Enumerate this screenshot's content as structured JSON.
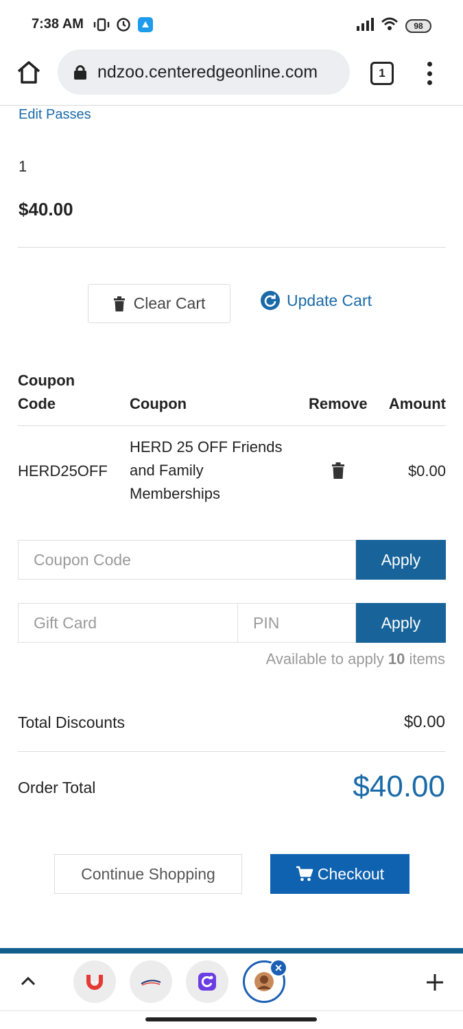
{
  "status_bar": {
    "time": "7:38 AM",
    "battery": "98"
  },
  "browser": {
    "url": "ndzoo.centeredgeonline.com",
    "tab_count": "1"
  },
  "cart_item": {
    "edit_link": "Edit Passes",
    "quantity": "1",
    "price": "$40.00"
  },
  "cart_actions": {
    "clear_label": "Clear Cart",
    "update_label": "Update Cart"
  },
  "coupon_table": {
    "headers": {
      "code_line1": "Coupon",
      "code_line2": "Code",
      "coupon": "Coupon",
      "remove": "Remove",
      "amount": "Amount"
    },
    "rows": [
      {
        "code": "HERD25OFF",
        "desc_line1": "HERD 25 OFF Friends",
        "desc_line2": "and Family",
        "desc_line3": "Memberships",
        "amount": "$0.00"
      }
    ]
  },
  "coupon_form": {
    "placeholder": "Coupon Code",
    "apply_label": "Apply"
  },
  "gift_card_form": {
    "card_placeholder": "Gift Card",
    "pin_placeholder": "PIN",
    "apply_label": "Apply"
  },
  "availability": {
    "prefix": "Available to apply",
    "count": "10",
    "suffix": "items"
  },
  "totals": {
    "discounts_label": "Total Discounts",
    "discounts_value": "$0.00",
    "order_label": "Order Total",
    "order_value": "$40.00"
  },
  "footer_actions": {
    "continue_label": "Continue Shopping",
    "checkout_label": "Checkout"
  },
  "tab_bar": {
    "apps": [
      "magnet-app-icon",
      "canty-app-icon",
      "refresh-app-icon",
      "profile-app-icon"
    ]
  },
  "colors": {
    "link_blue": "#1a6aa8",
    "apply_blue": "#17639a",
    "checkout_blue": "#0f62b0"
  }
}
